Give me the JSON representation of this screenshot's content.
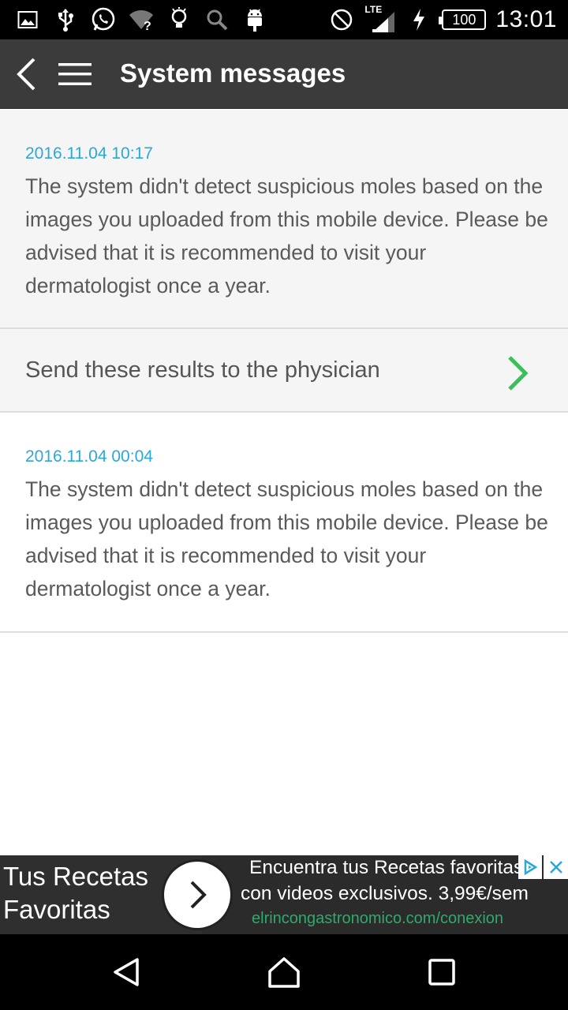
{
  "status_bar": {
    "time": "13:01",
    "battery": "100",
    "network": "LTE",
    "icons": [
      "gallery-icon",
      "usb-icon",
      "whatsapp-icon",
      "wifi-question-icon",
      "lightbulb-icon",
      "search-icon",
      "android-icon",
      "do-not-disturb-icon",
      "signal-icon",
      "charging-icon",
      "battery-icon"
    ]
  },
  "app_bar": {
    "title": "System messages",
    "back_icon": "chevron-left-icon",
    "menu_icon": "hamburger-menu-icon"
  },
  "messages": [
    {
      "date": "2016.11.04 10:17",
      "body": "The system didn't detect suspicious moles based on the images you uploaded from this mobile device. Please be advised that it is recommended to visit your dermatologist once a year."
    },
    {
      "date": "2016.11.04 00:04",
      "body": "The system didn't detect suspicious moles based on the images you uploaded from this mobile device. Please be advised that it is recommended to visit your dermatologist once a year."
    }
  ],
  "send_action": {
    "label": "Send these results to the physician",
    "icon": "chevron-right-icon",
    "accent": "#3cbf5a"
  },
  "ad": {
    "left_text": "Tus Recetas Favoritas",
    "line1": "Encuentra tus Recetas favoritas",
    "line2": "con videos exclusivos. 3,99€/sem",
    "url": "elrincongastronomico.com/conexion",
    "choices_icon": "ad-choices-icon",
    "close_icon": "close-icon"
  },
  "nav_bar": {
    "icons": [
      "nav-back-icon",
      "nav-home-icon",
      "nav-recents-icon"
    ]
  },
  "colors": {
    "app_bar": "#3b3b3b",
    "date": "#2aa8d8",
    "body_text": "#5a5a5a",
    "ad_url": "#2faa6a"
  }
}
